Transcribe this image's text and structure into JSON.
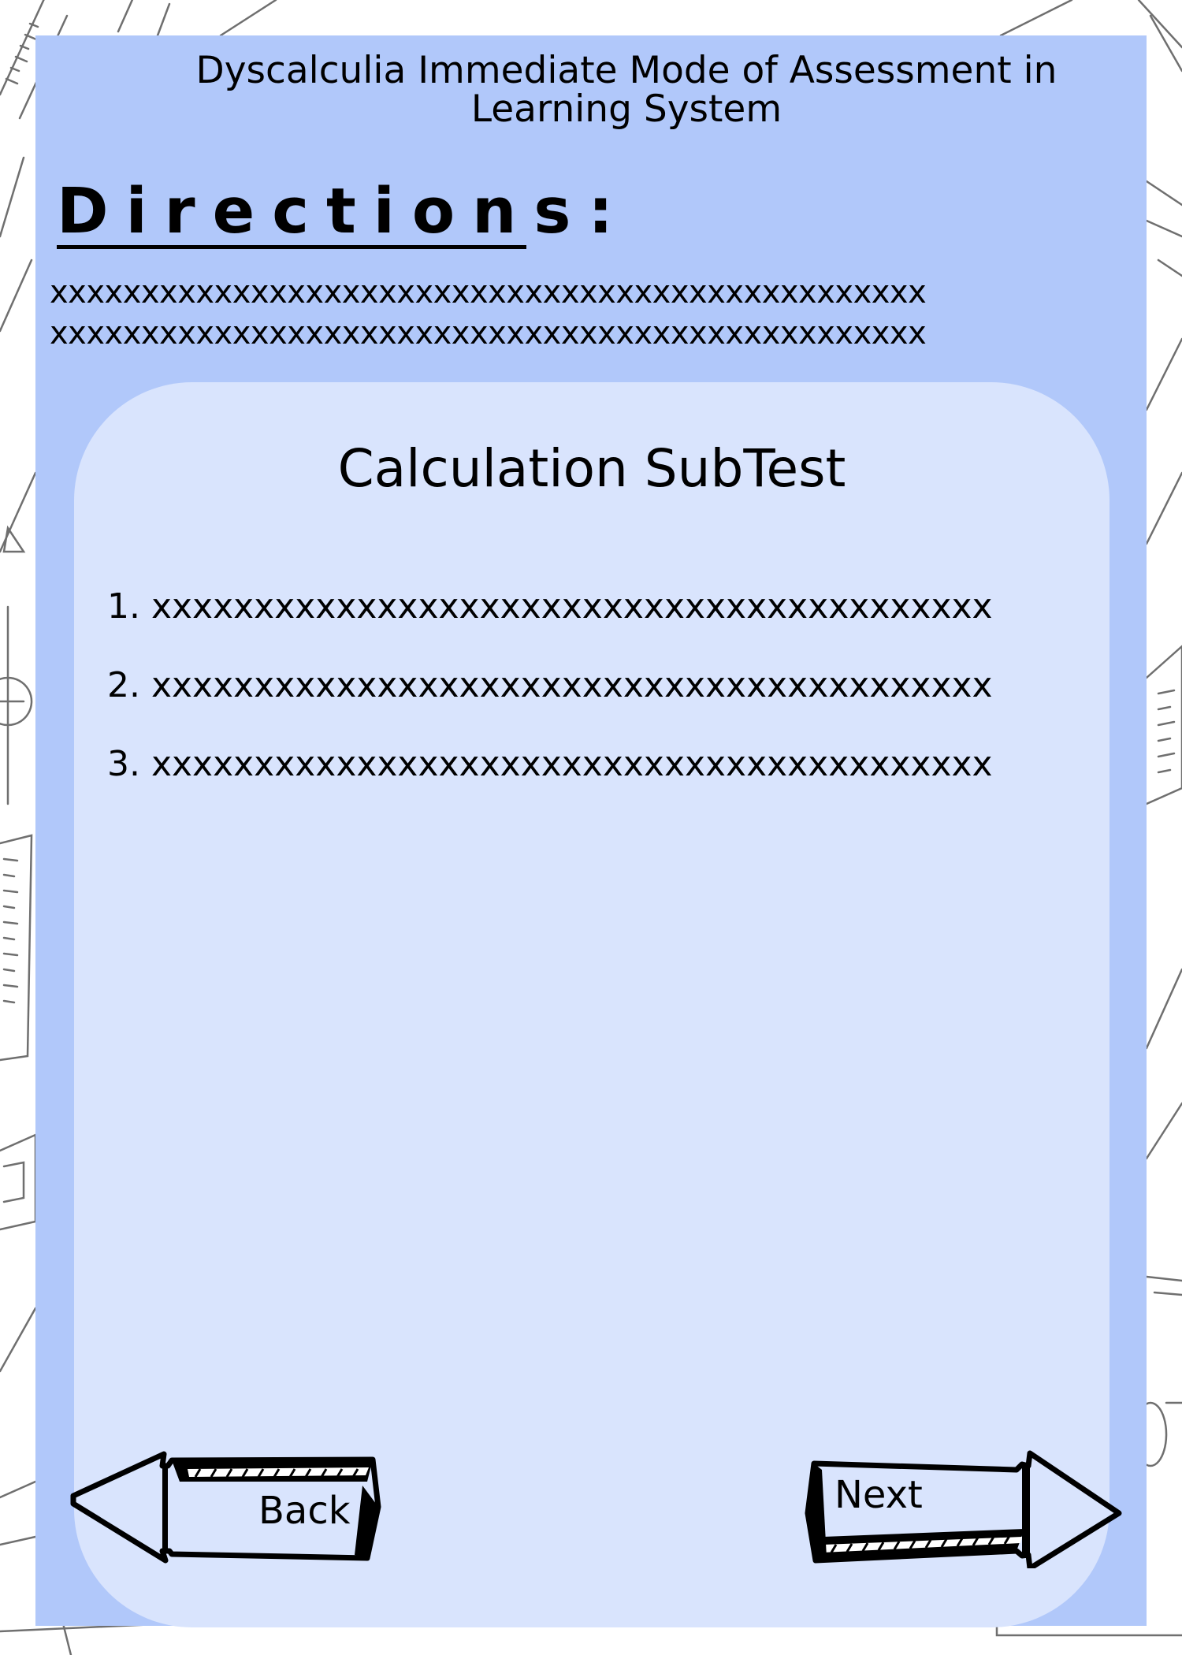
{
  "header": {
    "app_title": "Dyscalculia Immediate Mode of Assessment in\nLearning System"
  },
  "directions": {
    "heading": "Directions:",
    "lines": [
      "xxxxxxxxxxxxxxxxxxxxxxxxxxxxxxxxxxxxxxxxxxxxxxxx",
      "xxxxxxxxxxxxxxxxxxxxxxxxxxxxxxxxxxxxxxxxxxxxxxxx"
    ]
  },
  "card": {
    "title": "Calculation SubTest",
    "items": [
      "1. xxxxxxxxxxxxxxxxxxxxxxxxxxxxxxxxxxxxxxxxx",
      "2. xxxxxxxxxxxxxxxxxxxxxxxxxxxxxxxxxxxxxxxxx",
      "3. xxxxxxxxxxxxxxxxxxxxxxxxxxxxxxxxxxxxxxxxx"
    ]
  },
  "navigation": {
    "back_label": "Back",
    "next_label": "Next"
  },
  "colors": {
    "page_background": "#ffffff",
    "panel": "#b1c8fa",
    "card": "#d9e4fd",
    "text": "#000000",
    "sketch_lines": "#6f6f6f"
  },
  "icons": {
    "back": "left-arrow-icon",
    "next": "right-arrow-icon"
  }
}
